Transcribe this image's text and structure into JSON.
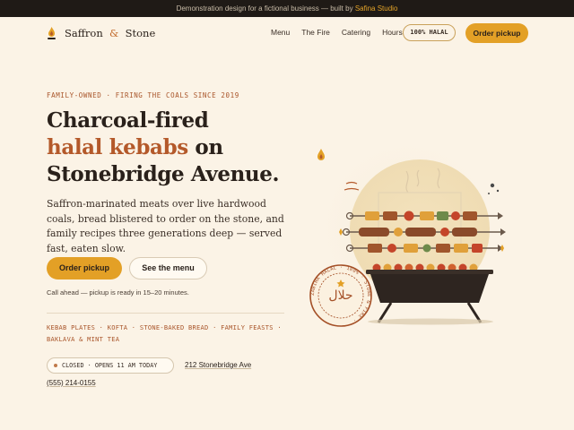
{
  "topbar": {
    "text": "Demonstration design for a fictional business — built by",
    "studio": "Safina Studio"
  },
  "brand": {
    "name_1": "Saffron",
    "amp": "&",
    "name_2": "Stone"
  },
  "nav": {
    "items": [
      "Menu",
      "The Fire",
      "Catering",
      "Hours"
    ]
  },
  "halal_badge": "100% HALAL",
  "header_cta": "Order pickup",
  "hero": {
    "eyebrow": "FAMILY-OWNED · FIRING THE COALS SINCE 2019",
    "headline_1": "Charcoal-fired",
    "headline_accent": "halal kebabs",
    "headline_2": " on",
    "headline_3": "Stonebridge Avenue.",
    "lede": "Saffron-marinated meats over live hardwood coals, bread blistered to order on the stone, and family recipes three generations deep — served fast, eaten slow.",
    "primary_cta": "Order pickup",
    "secondary_cta": "See the menu",
    "call_ahead": "Call ahead — pickup is ready in 15–20 minutes.",
    "tags": "KEBAB PLATES · KOFTA · STONE-BAKED BREAD · FAMILY FEASTS · BAKLAVA & MINT TEA"
  },
  "info": {
    "status": "CLOSED · OPENS 11 AM TODAY",
    "address": "212 Stonebridge Ave",
    "phone": "(555) 214-0155"
  },
  "seal": {
    "ring_text": "ZABIHA HALAL · 100% · STONE & FIRE ·",
    "arabic": "حلال"
  },
  "colors": {
    "accent": "#e3a026",
    "rust": "#b4592a",
    "background": "#fbf3e6",
    "topbar": "#1f1a16"
  }
}
